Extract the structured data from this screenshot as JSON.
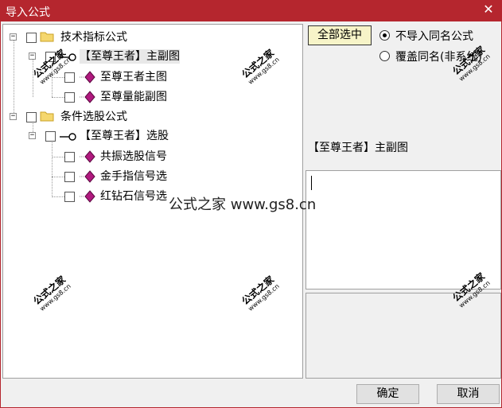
{
  "window": {
    "title": "导入公式",
    "close_glyph": "✕"
  },
  "tree": {
    "nodes": [
      {
        "label": "技术指标公式",
        "type": "folder",
        "expander": "−"
      },
      {
        "label": "【至尊王者】主副图",
        "type": "key",
        "expander": "−"
      },
      {
        "label": "至尊王者主图",
        "type": "formula"
      },
      {
        "label": "至尊量能副图",
        "type": "formula"
      },
      {
        "label": "条件选股公式",
        "type": "folder",
        "expander": "−"
      },
      {
        "label": "【至尊王者】选股",
        "type": "key",
        "expander": "−"
      },
      {
        "label": "共振选股信号",
        "type": "formula"
      },
      {
        "label": "金手指信号选",
        "type": "formula"
      },
      {
        "label": "红钻石信号选",
        "type": "formula"
      }
    ]
  },
  "options": {
    "select_all_label": "全部选中",
    "radio_no_import_label": "不导入同名公式",
    "radio_overwrite_label": "覆盖同名(非系统)",
    "selected_radio": "no_import"
  },
  "details": {
    "selected_name": "【至尊王者】主副图"
  },
  "footer": {
    "ok_label": "确定",
    "cancel_label": "取消"
  },
  "watermark": {
    "cn": "公式之家",
    "url": "www.gs8.cn",
    "center_text": "公式之家 www.gs8.cn"
  },
  "colors": {
    "titlebar": "#b5262e",
    "formula_icon": "#b0197e"
  }
}
